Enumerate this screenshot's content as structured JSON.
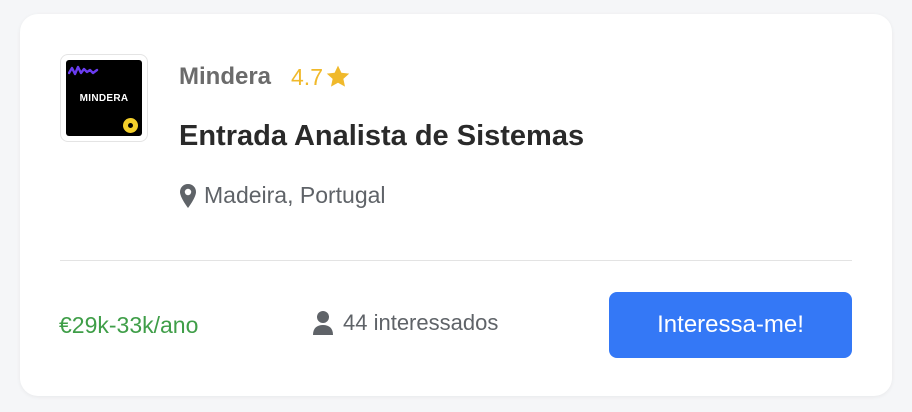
{
  "company": {
    "name": "Mindera",
    "rating": "4.7",
    "logo_text": "MINDERA"
  },
  "job": {
    "title": "Entrada Analista de Sistemas",
    "location": "Madeira, Portugal"
  },
  "footer": {
    "salary": "€29k-33k/ano",
    "interested": "44 interessados",
    "cta_label": "Interessa-me!"
  },
  "colors": {
    "accent": "#3478f6",
    "salary": "#3f9e48",
    "rating": "#f0b92b"
  },
  "icons": {
    "rating": "star-icon",
    "location": "map-pin-icon",
    "interested": "person-icon"
  }
}
